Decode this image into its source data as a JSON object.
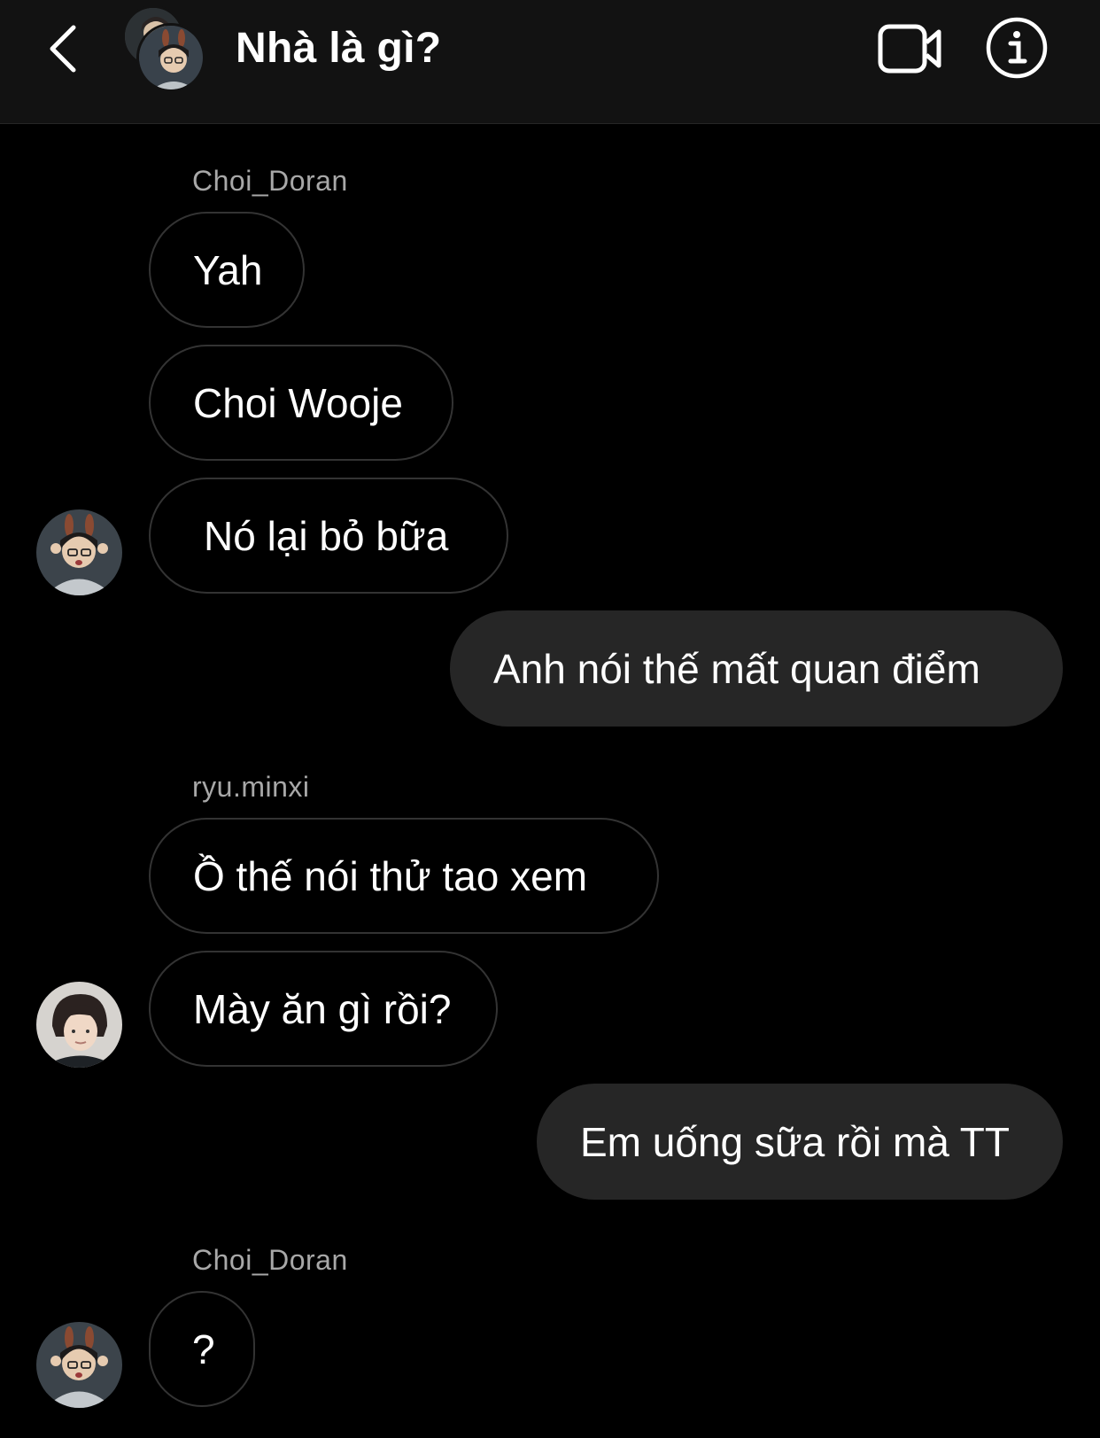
{
  "header": {
    "title": "Nhà là gì?",
    "back_icon": "chevron-left-icon",
    "video_icon": "video-camera-icon",
    "info_icon": "info-icon"
  },
  "messages": [
    {
      "type": "sender",
      "text": "Choi_Doran"
    },
    {
      "type": "in",
      "text": "Yah"
    },
    {
      "type": "in",
      "text": "Choi Wooje"
    },
    {
      "type": "in",
      "text": "Nó lại bỏ bữa"
    },
    {
      "type": "out",
      "text": "Anh nói thế mất quan điểm"
    },
    {
      "type": "sender",
      "text": "ryu.minxi"
    },
    {
      "type": "in",
      "text": "Ồ thế nói thử tao xem"
    },
    {
      "type": "in",
      "text": "Mày ăn gì rồi?"
    },
    {
      "type": "out",
      "text": "Em uống sữa rồi mà TT"
    },
    {
      "type": "sender",
      "text": "Choi_Doran"
    },
    {
      "type": "in",
      "text": "?"
    }
  ],
  "colors": {
    "background": "#000000",
    "header": "#121212",
    "outgoing_bubble": "#262626",
    "incoming_border": "#333333",
    "sender_name": "#a8a8a8"
  }
}
